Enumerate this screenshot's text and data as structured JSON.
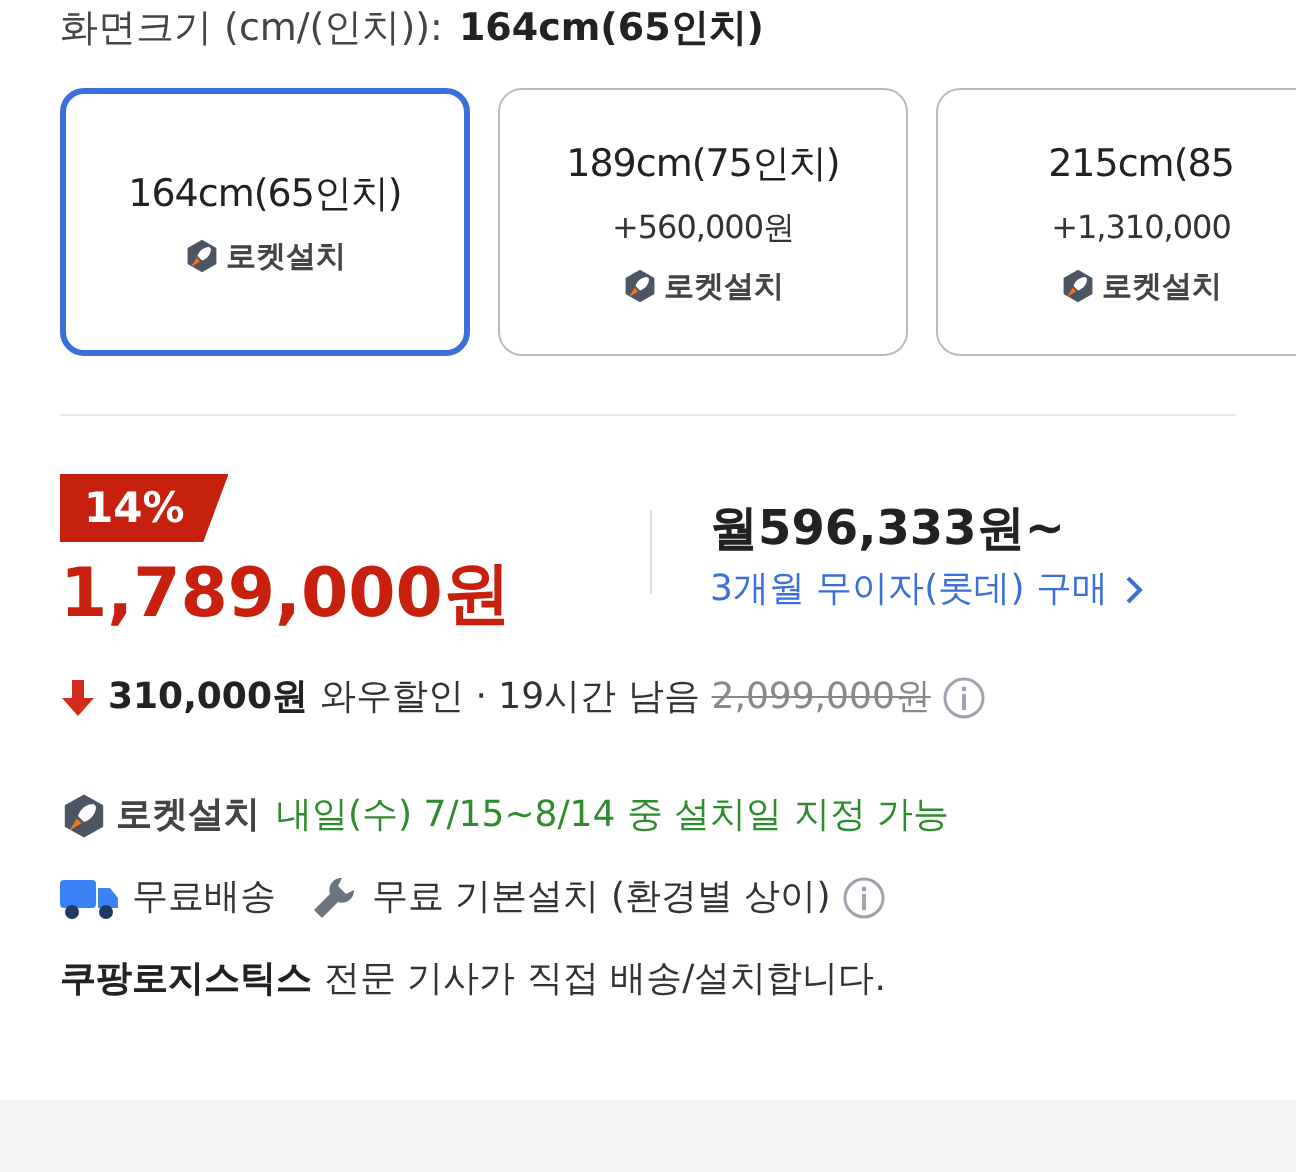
{
  "size_label": "화면크기 (cm/(인치)):",
  "size_value": "164cm(65인치)",
  "options": [
    {
      "label": "164cm(65인치)",
      "selected": true,
      "badge": "로켓설치"
    },
    {
      "label": "189cm(75인치)",
      "price": "+560,000원",
      "selected": false,
      "badge": "로켓설치"
    },
    {
      "label": "215cm(85",
      "price": "+1,310,000",
      "selected": false,
      "badge": "로켓설치"
    }
  ],
  "discount_badge": "14%",
  "price": "1,789,000원",
  "monthly": "월596,333원~",
  "installment_link": "3개월 무이자(롯데) 구매",
  "discount_amount": "310,000원",
  "discount_note": "와우할인 · 19시간 남음",
  "original_price": "2,099,000원",
  "rocket_label": "로켓설치",
  "rocket_note": "내일(수) 7/15~8/14 중 설치일 지정 가능",
  "free_delivery": "무료배송",
  "free_install": "무료 기본설치 (환경별 상이)",
  "logistics_name": "쿠팡로지스틱스",
  "logistics_note": "전문 기사가 직접 배송/설치합니다."
}
